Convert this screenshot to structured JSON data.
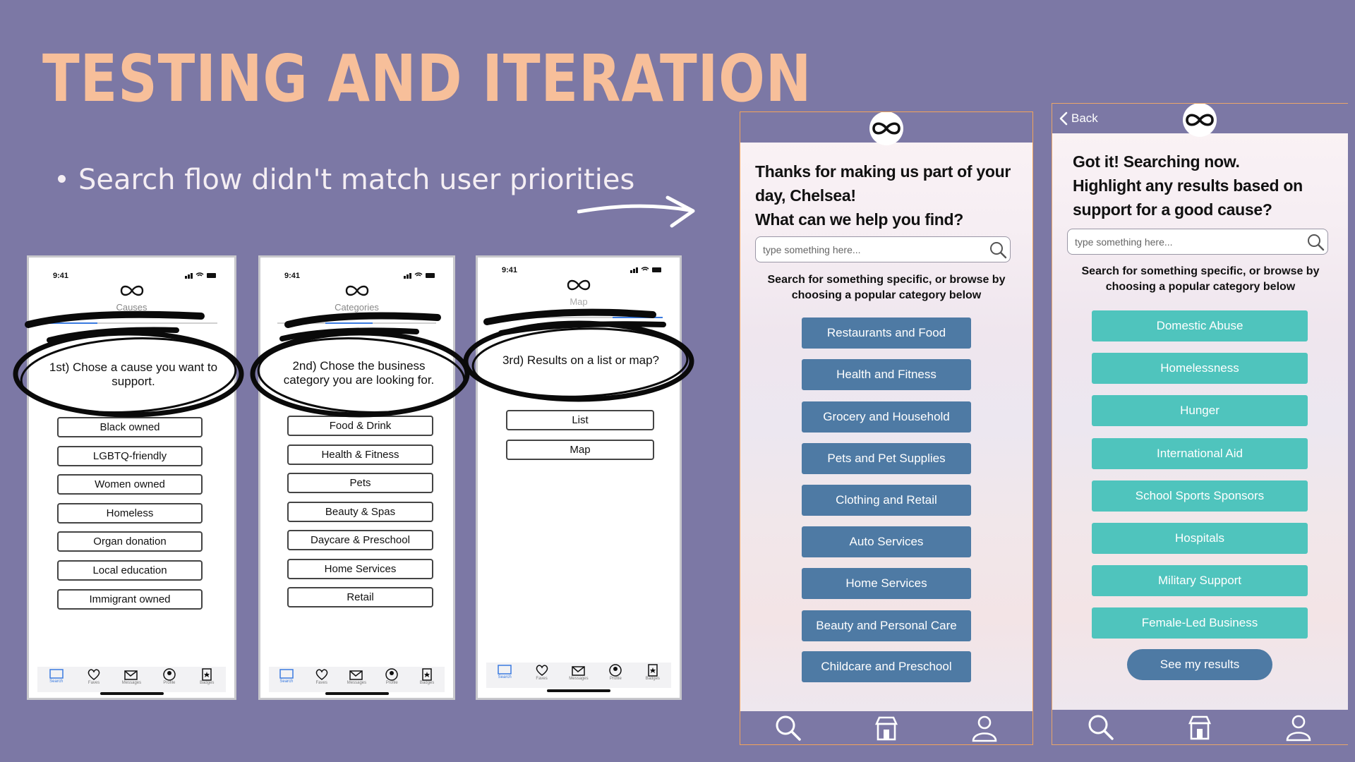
{
  "slide": {
    "title": "TESTING AND ITERATION",
    "bullet": "Search flow didn't match user priorities"
  },
  "wireframes": [
    {
      "time": "9:41",
      "subtitle": "Causes",
      "prompt": "1st) Chose a cause you want to support.",
      "buttons": [
        "Black owned",
        "LGBTQ-friendly",
        "Women owned",
        "Homeless",
        "Organ donation",
        "Local education",
        "Immigrant owned"
      ],
      "tabs": [
        "Search",
        "Faves",
        "Messages",
        "Profile",
        "Badges"
      ]
    },
    {
      "time": "9:41",
      "subtitle": "Categories",
      "prompt": "2nd) Chose the business category you are looking for.",
      "buttons": [
        "Food & Drink",
        "Health & Fitness",
        "Pets",
        "Beauty & Spas",
        "Daycare & Preschool",
        "Home Services",
        "Retail"
      ],
      "tabs": [
        "Search",
        "Faves",
        "Messages",
        "Profile",
        "Badges"
      ]
    },
    {
      "time": "9:41",
      "subtitle": "Map",
      "prompt": "3rd) Results on a list or map?",
      "buttons": [
        "List",
        "Map"
      ],
      "tabs": [
        "Search",
        "Faves",
        "Messages",
        "Profile",
        "Badges"
      ]
    }
  ],
  "phone1": {
    "heading_1": "Thanks for making us part of your",
    "heading_2": "day, Chelsea!",
    "heading_3": "What can we help you find?",
    "search_placeholder": "type something here...",
    "hint": "Search for something specific, or browse by choosing a popular category below",
    "categories": [
      "Restaurants and Food",
      "Health and Fitness",
      "Grocery and Household",
      "Pets and Pet Supplies",
      "Clothing and Retail",
      "Auto Services",
      "Home Services",
      "Beauty and Personal Care",
      "Childcare and Preschool"
    ]
  },
  "phone2": {
    "back_label": "Back",
    "heading_1": "Got it! Searching now.",
    "heading_2": "Highlight any results based on",
    "heading_3": "support for a good cause?",
    "search_placeholder": "type something here...",
    "hint": "Search for something specific, or browse by choosing a popular category below",
    "causes": [
      "Domestic Abuse",
      "Homelessness",
      "Hunger",
      "International Aid",
      "School Sports Sponsors",
      "Hospitals",
      "Military Support",
      "Female-Led Business"
    ],
    "see_results": "See my results"
  },
  "colors": {
    "background": "#7c78a5",
    "title": "#f7bf9a",
    "category_button": "#4e7aa4",
    "cause_button": "#4fc4bd"
  },
  "icons": [
    "infinity-logo-icon",
    "search-icon",
    "store-icon",
    "profile-icon",
    "chevron-left-icon",
    "heart-icon",
    "messages-icon",
    "badge-icon",
    "arrow-icon"
  ]
}
